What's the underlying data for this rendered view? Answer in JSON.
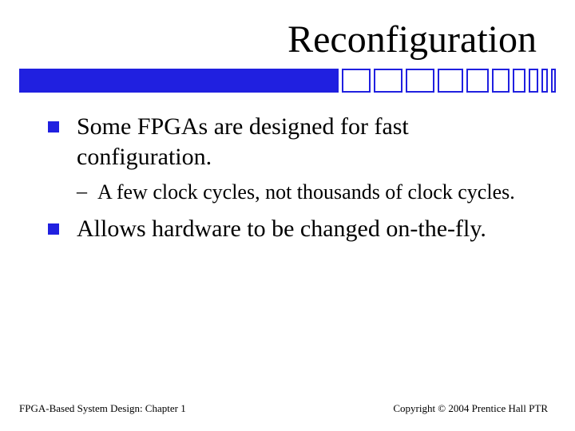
{
  "title": "Reconfiguration",
  "bullets": {
    "b1": "Some FPGAs are designed for fast configuration.",
    "b1_sub1": "A few clock cycles, not thousands of clock cycles.",
    "b2": "Allows hardware to be changed on-the-fly."
  },
  "footer": {
    "left": "FPGA-Based System Design: Chapter 1",
    "right": "Copyright © 2004 Prentice Hall PTR"
  },
  "colors": {
    "accent": "#2020e0"
  }
}
